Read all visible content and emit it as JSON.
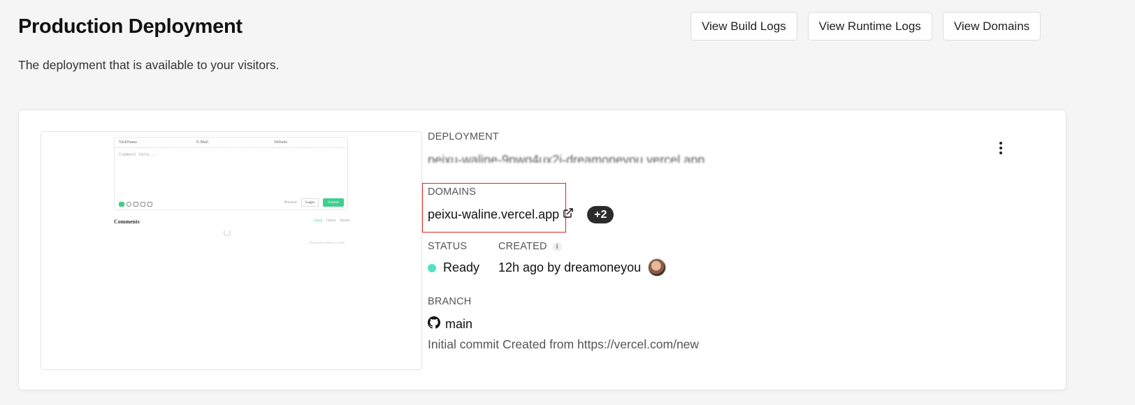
{
  "header": {
    "title": "Production Deployment",
    "subtitle": "The deployment that is available to your visitors.",
    "actions": {
      "build_logs": "View Build Logs",
      "runtime_logs": "View Runtime Logs",
      "domains": "View Domains"
    }
  },
  "preview": {
    "fields": [
      "NickName",
      "E-Mail",
      "Website"
    ],
    "placeholder": "Comment here...",
    "preview_label": "Preview",
    "login": "Login",
    "submit": "Submit",
    "comments_title": "Comments",
    "sort_tabs": [
      "Latest",
      "Oldest",
      "Hottest"
    ],
    "powered_by": "Powered by Waline v2.14.8"
  },
  "deployment": {
    "label": "Deployment",
    "url": "peixu-waline-9pwg4ux2i-dreamoneyou.vercel.app"
  },
  "domains": {
    "label": "Domains",
    "primary": "peixu-waline.vercel.app",
    "extra_count": "+2"
  },
  "status": {
    "label": "Status",
    "value": "Ready",
    "color": "#50e3c2"
  },
  "created": {
    "label": "Created",
    "value": "12h ago by dreamoneyou"
  },
  "branch": {
    "label": "Branch",
    "value": "main",
    "commit_message": "Initial commit Created from https://vercel.com/new"
  },
  "icons": {
    "external_link": "external-link-icon",
    "github": "github-icon",
    "info": "info-icon",
    "more": "more-vertical-icon"
  }
}
